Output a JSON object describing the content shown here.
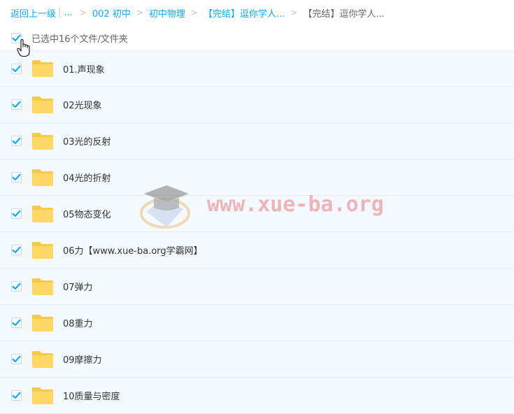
{
  "breadcrumb": {
    "back": "返回上一级",
    "ellipsis": "...",
    "items": [
      "002 初中",
      "初中物理",
      "【完结】逗你学人..."
    ],
    "current": "【完结】逗你学人..."
  },
  "selection": {
    "count_text": "已选中16个文件/文件夹",
    "checked": true
  },
  "files": [
    {
      "name": "01.声现象"
    },
    {
      "name": "02光现象"
    },
    {
      "name": "03光的反射"
    },
    {
      "name": "04光的折射"
    },
    {
      "name": "05物态变化"
    },
    {
      "name": "06力【www.xue-ba.org学霸网】"
    },
    {
      "name": "07弹力"
    },
    {
      "name": "08重力"
    },
    {
      "name": "09摩擦力"
    },
    {
      "name": "10质量与密度"
    }
  ],
  "watermark": {
    "text": "www.xue-ba.org"
  },
  "colors": {
    "accent": "#09aaff",
    "row_bg": "#f3f9fe",
    "row_border": "#d9ecfb",
    "folder": "#ffd766"
  }
}
